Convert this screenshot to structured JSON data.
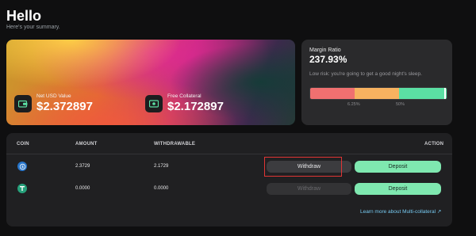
{
  "header": {
    "title": "Hello",
    "subtitle": "Here's your summary."
  },
  "hero": {
    "net_usd": {
      "label": "Net USD Value",
      "value": "$2.372897"
    },
    "free_collateral": {
      "label": "Free Collateral",
      "value": "$2.172897"
    }
  },
  "margin": {
    "label": "Margin Ratio",
    "value": "237.93%",
    "description": "Low risk: you're going to get a good night's sleep.",
    "tick_low": "6.25%",
    "tick_high": "50%",
    "colors": {
      "low": "#f07070",
      "mid": "#f7b260",
      "high": "#5be0a4"
    }
  },
  "table": {
    "columns": {
      "coin": "COIN",
      "amount": "AMOUNT",
      "withdrawable": "WITHDRAWABLE",
      "action": "ACTION"
    },
    "rows": [
      {
        "icon": "usdc-icon",
        "amount": "2.3729",
        "withdrawable": "2.1729",
        "withdraw_label": "Withdraw",
        "deposit_label": "Deposit"
      },
      {
        "icon": "usdt-icon",
        "amount": "0.0000",
        "withdrawable": "0.0000",
        "withdraw_label": "Withdraw",
        "deposit_label": "Deposit"
      }
    ],
    "learn_more": "Learn more about Multi-collateral ↗"
  },
  "colors": {
    "accent_green": "#7fe8b0",
    "link_blue": "#76c9f0",
    "highlight_red": "#e03535"
  }
}
